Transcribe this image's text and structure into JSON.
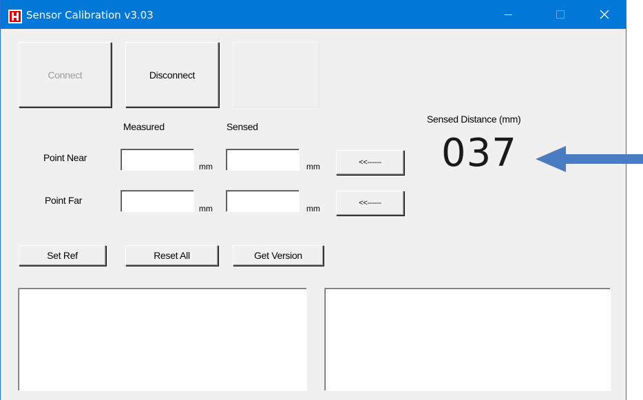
{
  "window": {
    "title": "Sensor Calibration v3.03",
    "logo_letter": "H",
    "accent": "#0078d7",
    "logo_color": "#e00000"
  },
  "buttons": {
    "connect": "Connect",
    "disconnect": "Disconnect",
    "blank": "",
    "copy_near": "<<------",
    "copy_far": "<<------",
    "set_ref": "Set Ref",
    "reset_all": "Reset All",
    "get_version": "Get Version"
  },
  "columns": {
    "measured": "Measured",
    "sensed": "Sensed"
  },
  "rows": {
    "near": {
      "label": "Point Near",
      "measured_value": "",
      "sensed_value": "",
      "measured_unit": "mm",
      "sensed_unit": "mm"
    },
    "far": {
      "label": "Point Far",
      "measured_value": "",
      "sensed_value": "",
      "measured_unit": "mm",
      "sensed_unit": "mm"
    }
  },
  "readout": {
    "label": "Sensed Distance (mm)",
    "value": "037",
    "arrow_color": "#4a7cc4"
  },
  "icons": {
    "minimize": "minimize-icon",
    "maximize": "maximize-icon",
    "close": "close-icon",
    "pointer": "arrow-left-icon"
  }
}
